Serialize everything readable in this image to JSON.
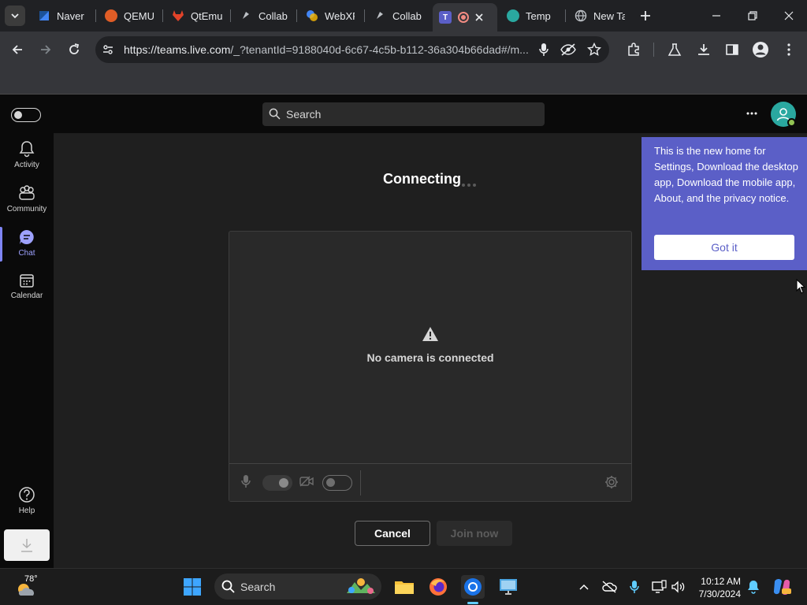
{
  "browser": {
    "tabs": [
      {
        "label": "Naver",
        "fav_color": "#03c75a",
        "fav_glyph": ""
      },
      {
        "label": "QEMU",
        "fav_color": "#e05d26",
        "fav_glyph": ""
      },
      {
        "label": "QtEmu",
        "fav_color": "#e24329",
        "fav_glyph": ""
      },
      {
        "label": "Collab",
        "fav_color": "#9aa0a6",
        "fav_glyph": ""
      },
      {
        "label": "WebXF",
        "fav_color": "#4285f4",
        "fav_glyph": ""
      },
      {
        "label": "Collab",
        "fav_color": "#9aa0a6",
        "fav_glyph": ""
      },
      {
        "label": "",
        "fav_color": "#5b5fc7",
        "fav_glyph": "T"
      },
      {
        "label": "Temp",
        "fav_color": "#2aa8a0",
        "fav_glyph": ""
      },
      {
        "label": "New Ta",
        "fav_color": "#9aa0a6",
        "fav_glyph": ""
      }
    ],
    "url_host": "https://teams.live.com",
    "url_rest": "/_?tenantId=9188040d-6c67-4c5b-b112-36a304b66dad#/m..."
  },
  "teams": {
    "search_placeholder": "Search",
    "more_label": "···",
    "rail": [
      {
        "label": "Activity",
        "icon": "bell-icon"
      },
      {
        "label": "Community",
        "icon": "community-icon"
      },
      {
        "label": "Chat",
        "icon": "chat-icon",
        "active": true
      },
      {
        "label": "Calendar",
        "icon": "calendar-icon"
      },
      {
        "label": "Help",
        "icon": "help-icon"
      }
    ],
    "connecting_label": "Connecting",
    "no_camera_label": "No camera is connected",
    "cancel_label": "Cancel",
    "join_label": "Join now",
    "callout_text": "This is the new home for Settings, Download the desktop app, Download the mobile app, About, and the privacy notice.",
    "got_it_label": "Got it"
  },
  "taskbar": {
    "weather_temp": "78°",
    "search_label": "Search",
    "time": "10:12 AM",
    "date": "7/30/2024"
  },
  "colors": {
    "accent": "#5b5fc7",
    "rail_active": "#7f85f5",
    "presence": "#92c353"
  }
}
